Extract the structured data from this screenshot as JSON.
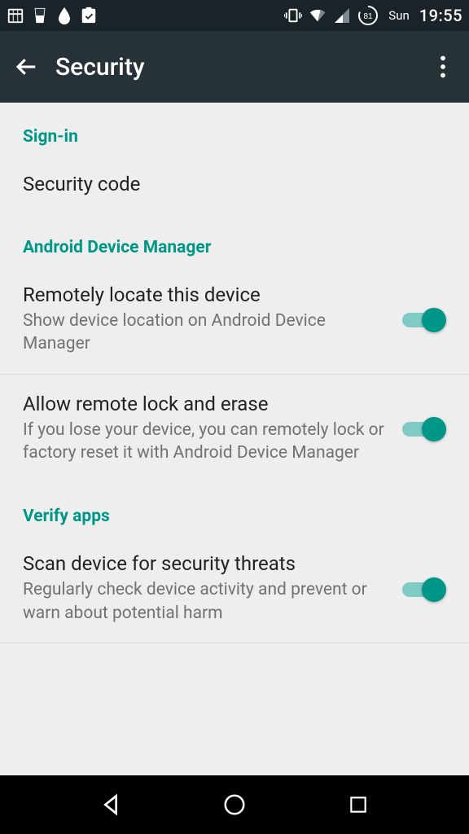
{
  "status": {
    "battery_pct": "81",
    "day": "Sun",
    "time": "19:55"
  },
  "toolbar": {
    "title": "Security"
  },
  "sections": {
    "signin": {
      "header": "Sign-in"
    },
    "adm": {
      "header": "Android Device Manager"
    },
    "verify": {
      "header": "Verify apps"
    }
  },
  "items": {
    "security_code": {
      "title": "Security code"
    },
    "remote_locate": {
      "title": "Remotely locate this device",
      "subtitle": "Show device location on Android Device Manager",
      "enabled": true
    },
    "remote_lock": {
      "title": "Allow remote lock and erase",
      "subtitle": "If you lose your device, you can remotely lock or factory reset it with Android Device Manager",
      "enabled": true
    },
    "scan_threats": {
      "title": "Scan device for security threats",
      "subtitle": "Regularly check device activity and prevent or warn about potential harm",
      "enabled": true
    }
  },
  "colors": {
    "accent": "#009688",
    "toolbar_bg": "#263238"
  }
}
